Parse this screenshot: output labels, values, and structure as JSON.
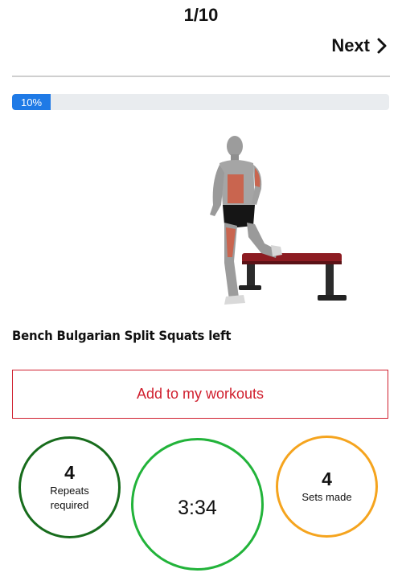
{
  "header": {
    "counter": "1/10",
    "next_label": "Next"
  },
  "progress": {
    "label": "10%",
    "fraction": 0.1,
    "color": "#1f7ae6"
  },
  "exercise": {
    "title": "Bench Bulgarian Split Squats left"
  },
  "actions": {
    "add_label": "Add to my workouts",
    "accent_color": "#d0202f"
  },
  "stats": {
    "repeats": {
      "value": "4",
      "label": "Repeats required",
      "color": "#176c1c"
    },
    "timer": {
      "value": "3:34",
      "color": "#22b33a"
    },
    "sets": {
      "value": "4",
      "label": "Sets made",
      "color": "#f5a41e"
    }
  }
}
